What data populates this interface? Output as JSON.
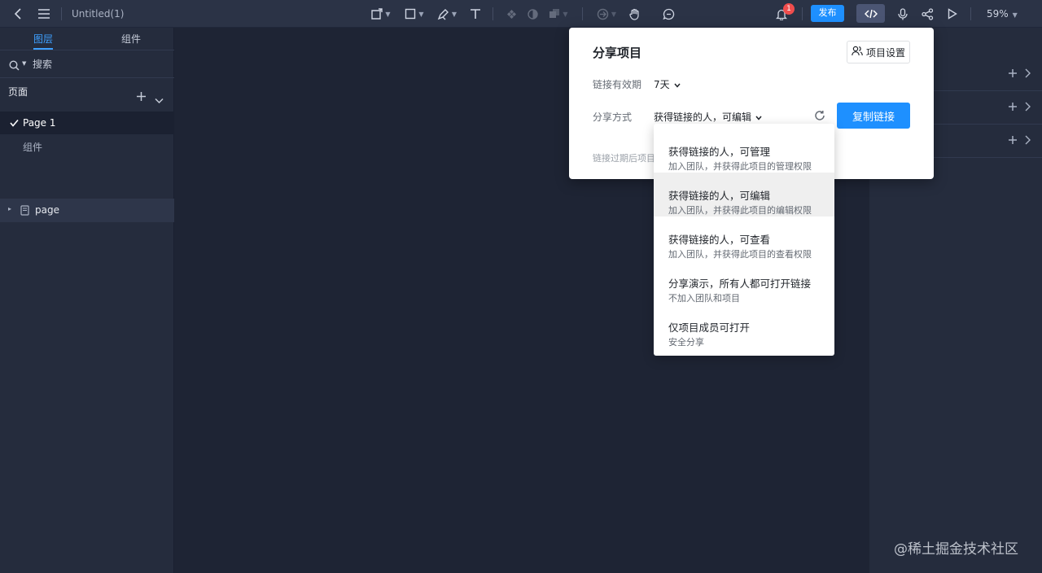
{
  "toolbar": {
    "doc_title": "Untitled(1)",
    "notification_count": "1",
    "publish_label": "发布",
    "zoom_label": "59%",
    "icons": [
      "back-icon",
      "menu-icon",
      "frame-tool-icon",
      "shape-tool-icon",
      "pen-tool-icon",
      "text-tool-icon",
      "component-icon",
      "mask-icon",
      "boolean-icon",
      "prototype-icon",
      "hand-tool-icon",
      "comment-icon",
      "bell-icon",
      "code-icon",
      "microphone-icon",
      "share-icon",
      "play-icon"
    ]
  },
  "sidebar": {
    "tab_layers": "图层",
    "tab_components": "组件",
    "search_placeholder": "搜索",
    "pages_heading": "页面",
    "pages": [
      {
        "label": "Page 1",
        "selected": true
      },
      {
        "label": "组件",
        "selected": false
      }
    ],
    "layer_label": "page"
  },
  "share_dialog": {
    "title": "分享项目",
    "settings_button": "项目设置",
    "expiry_label": "链接有效期",
    "expiry_value": "7天",
    "mode_label": "分享方式",
    "mode_value": "获得链接的人，可编辑",
    "copy_button": "复制链接",
    "footnote": "链接过期后项目"
  },
  "share_options": [
    {
      "title": "获得链接的人，可管理",
      "subtitle": "加入团队，并获得此项目的管理权限",
      "highlighted": false
    },
    {
      "title": "获得链接的人，可编辑",
      "subtitle": "加入团队，并获得此项目的编辑权限",
      "highlighted": true
    },
    {
      "title": "获得链接的人，可查看",
      "subtitle": "加入团队，并获得此项目的查看权限",
      "highlighted": false
    },
    {
      "title": "分享演示，所有人都可打开链接",
      "subtitle": "不加入团队和项目",
      "highlighted": false
    },
    {
      "title": "仅项目成员可打开",
      "subtitle": "安全分享",
      "highlighted": false
    }
  ],
  "watermark": "@稀土掘金技术社区",
  "colors": {
    "accent": "#1e90ff",
    "toolbar_bg": "#2b3346",
    "panel_bg": "#252c3d",
    "canvas_bg": "#1e2434",
    "badge": "#f04d4d"
  }
}
